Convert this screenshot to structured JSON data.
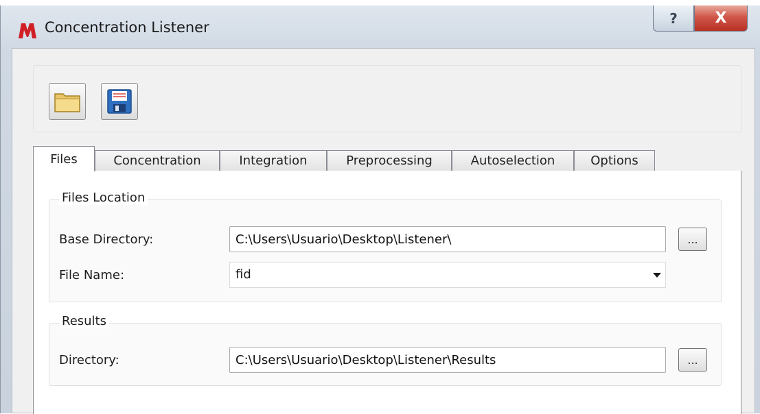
{
  "window": {
    "title": "Concentration Listener",
    "help_glyph": "?",
    "close_glyph": "X"
  },
  "toolbar": {
    "open_icon": "folder-open-icon",
    "save_icon": "floppy-save-icon"
  },
  "tabs": [
    {
      "label": "Files",
      "active": true
    },
    {
      "label": "Concentration",
      "active": false
    },
    {
      "label": "Integration",
      "active": false
    },
    {
      "label": "Preprocessing",
      "active": false
    },
    {
      "label": "Autoselection",
      "active": false
    },
    {
      "label": "Options",
      "active": false
    }
  ],
  "files_location": {
    "title": "Files Location",
    "base_directory_label": "Base Directory:",
    "base_directory_value": "C:\\Users\\Usuario\\Desktop\\Listener\\",
    "file_name_label": "File Name:",
    "file_name_value": "fid",
    "browse_label": "..."
  },
  "results": {
    "title": "Results",
    "directory_label": "Directory:",
    "directory_value": "C:\\Users\\Usuario\\Desktop\\Listener\\Results",
    "browse_label": "..."
  },
  "colors": {
    "close_button": "#c8443a",
    "title_bar": "#d3dce6",
    "panel": "#f0f0f0"
  }
}
